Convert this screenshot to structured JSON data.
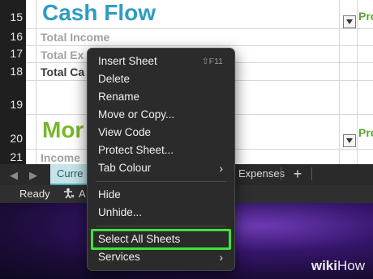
{
  "sheet": {
    "rows": [
      "15",
      "16",
      "17",
      "18",
      "19",
      "20",
      "21"
    ],
    "title_cash_flow": "Cash Flow",
    "title_monthly": "Mor",
    "label_total_income": "Total Income",
    "label_total_expenses": "Total Ex",
    "label_total_cash": "Total Ca",
    "label_income": "Income",
    "pro_top": "Pro",
    "pro_mid": "Pro",
    "colors": {
      "title_blue": "#2e9cc3",
      "title_green": "#76b82a",
      "pro_green": "#5aa432"
    }
  },
  "tabs": {
    "current_label": "Curre",
    "expenses_label": "Expenses",
    "add_label": "+",
    "prev_icon": "chevron-left-icon",
    "next_icon": "chevron-right-icon"
  },
  "status": {
    "ready": "Ready",
    "accessibility_label": "A"
  },
  "menu": {
    "items": [
      {
        "label": "Insert Sheet",
        "shortcut": "⇧F11"
      },
      {
        "label": "Delete"
      },
      {
        "label": "Rename"
      },
      {
        "label": "Move or Copy..."
      },
      {
        "label": "View Code"
      },
      {
        "label": "Protect Sheet..."
      },
      {
        "label": "Tab Colour",
        "submenu": true
      },
      {
        "label": "Hide"
      },
      {
        "label": "Unhide..."
      },
      {
        "label": "Select All Sheets",
        "highlighted": true
      },
      {
        "label": "Services",
        "submenu": true
      }
    ],
    "highlight_color": "#3fe23a"
  },
  "watermark": {
    "bold": "wiki",
    "light": "How"
  }
}
